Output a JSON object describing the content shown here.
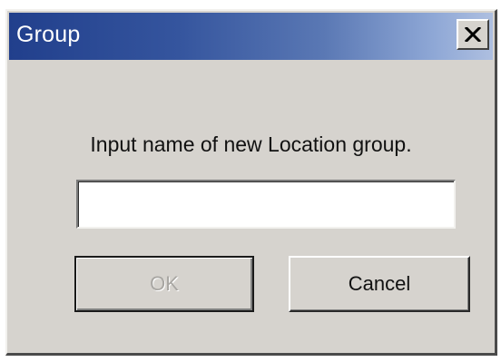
{
  "dialog": {
    "title": "Group",
    "prompt": "Input name of new Location group.",
    "input_value": "",
    "ok_label": "OK",
    "cancel_label": "Cancel",
    "ok_enabled": false,
    "icons": {
      "close": "close-icon"
    },
    "colors": {
      "titlebar_start": "#213f8c",
      "titlebar_end": "#aebfe0",
      "face": "#d6d3ce",
      "disabled_text": "#a8a6a2"
    }
  }
}
